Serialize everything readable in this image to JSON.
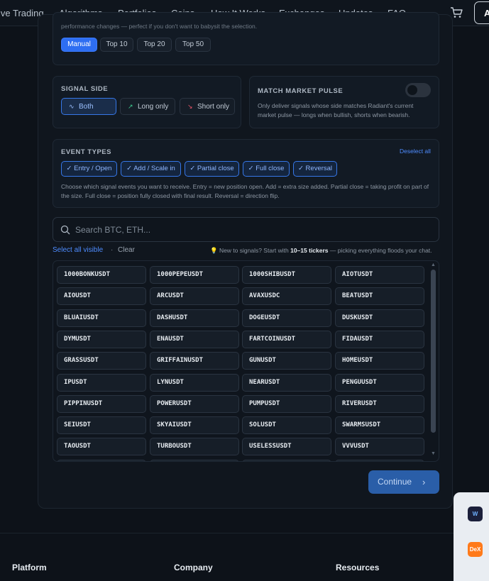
{
  "nav": {
    "items": [
      "ive Trading",
      "Algorithms",
      "Portfolios",
      "Coins",
      "How It Works",
      "Exchanges",
      "Updates",
      "FAQ"
    ],
    "account_label": "A"
  },
  "preset": {
    "cut_text": "performance changes — perfect if you don't want to babysit the selection.",
    "options": [
      "Manual",
      "Top 10",
      "Top 20",
      "Top 50"
    ],
    "selected": "Manual"
  },
  "signal_side": {
    "title": "SIGNAL SIDE",
    "options": [
      "Both",
      "Long only",
      "Short only"
    ],
    "selected": "Both"
  },
  "market_pulse": {
    "title": "MATCH MARKET PULSE",
    "description": "Only deliver signals whose side matches Radiant's current market pulse — longs when bullish, shorts when bearish.",
    "enabled": false
  },
  "event_types": {
    "title": "EVENT TYPES",
    "deselect_label": "Deselect all",
    "types": [
      "✓ Entry / Open",
      "✓ Add / Scale in",
      "✓ Partial close",
      "✓ Full close",
      "✓ Reversal"
    ],
    "description": "Choose which signal events you want to receive. Entry = new position open. Add = extra size added. Partial close = taking profit on part of the size. Full close = position fully closed with final result. Reversal = direction flip."
  },
  "search": {
    "placeholder": "Search BTC, ETH...",
    "value": ""
  },
  "selection": {
    "select_all_label": "Select all visible",
    "separator": "·",
    "clear_label": "Clear",
    "tip_prefix": "💡 New to signals? Start with ",
    "tip_bold": "10–15 tickers",
    "tip_suffix": " — picking everything floods your chat."
  },
  "tickers": [
    "1000BONKUSDT",
    "1000PEPEUSDT",
    "1000SHIBUSDT",
    "AIOTUSDT",
    "AIOUSDT",
    "ARCUSDT",
    "AVAXUSDC",
    "BEATUSDT",
    "BLUAIUSDT",
    "DASHUSDT",
    "DOGEUSDT",
    "DUSKUSDT",
    "DYMUSDT",
    "ENAUSDT",
    "FARTCOINUSDT",
    "FIDAUSDT",
    "GRASSUSDT",
    "GRIFFAINUSDT",
    "GUNUSDT",
    "HOMEUSDT",
    "IPUSDT",
    "LYNUSDT",
    "NEARUSDT",
    "PENGUUSDT",
    "PIPPINUSDT",
    "POWERUSDT",
    "PUMPUSDT",
    "RIVERUSDT",
    "SEIUSDT",
    "SKYAIUSDT",
    "SOLUSDT",
    "SWARMSUSDT",
    "TAOUSDT",
    "TURBOUSDT",
    "USELESSUSDT",
    "VVVUSDT"
  ],
  "continue_label": "Continue",
  "footer": {
    "columns": [
      "Platform",
      "Company",
      "Resources"
    ]
  },
  "floating_apps": [
    "W",
    "DeX"
  ],
  "colors": {
    "accent": "#2e6ef2",
    "link": "#4e8cff",
    "background": "#0d1219"
  }
}
